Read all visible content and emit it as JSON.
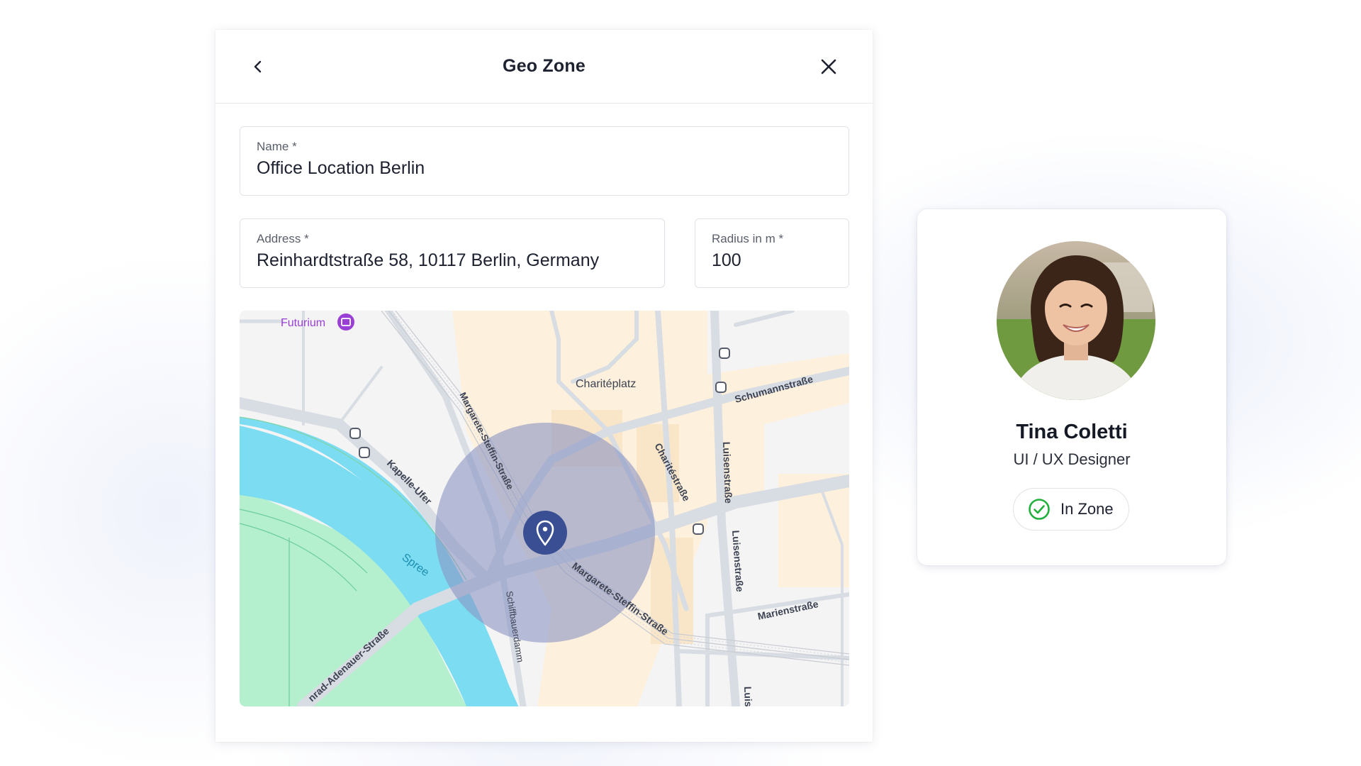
{
  "panel": {
    "title": "Geo Zone",
    "back_icon": "chevron-left-icon",
    "close_icon": "close-icon"
  },
  "form": {
    "name": {
      "label": "Name *",
      "value": "Office Location Berlin"
    },
    "address": {
      "label": "Address *",
      "value": "Reinhardtstraße 58, 10117 Berlin, Germany"
    },
    "radius": {
      "label": "Radius in m *",
      "value": "100"
    }
  },
  "map": {
    "labels": {
      "futurium": "Futurium",
      "chariteplatz": "Charitéplatz",
      "schumannstrasse": "Schumannstraße",
      "margarete_1": "Margarete-Steffin-Straße",
      "margarete_2": "Margarete-Steffin-Straße",
      "kapelle_ufer": "Kapelle-Ufer",
      "spree": "Spree",
      "charitestrasse": "Charitéstraße",
      "luisenstrasse_1": "Luisenstraße",
      "luisenstrasse_2": "Luisenstraße",
      "luisenstrasse_3": "Luis",
      "marienstrasse": "Marienstraße",
      "schiffbauerdamm": "Schiffbauerdamm",
      "adenauer": "nrad-Adenauer-Straße"
    },
    "pin_icon": "location-pin-icon",
    "colors": {
      "water": "#7cdcf2",
      "park": "#b4f0cd",
      "zone": "#8a95c3",
      "pin": "#3a4f93",
      "buildings": "#fdf0dc",
      "poi": "#9a3fd6"
    }
  },
  "profile": {
    "name": "Tina Coletti",
    "role": "UI / UX Designer",
    "status": "In Zone",
    "status_icon": "check-circle-icon",
    "status_color": "#22b03c"
  }
}
